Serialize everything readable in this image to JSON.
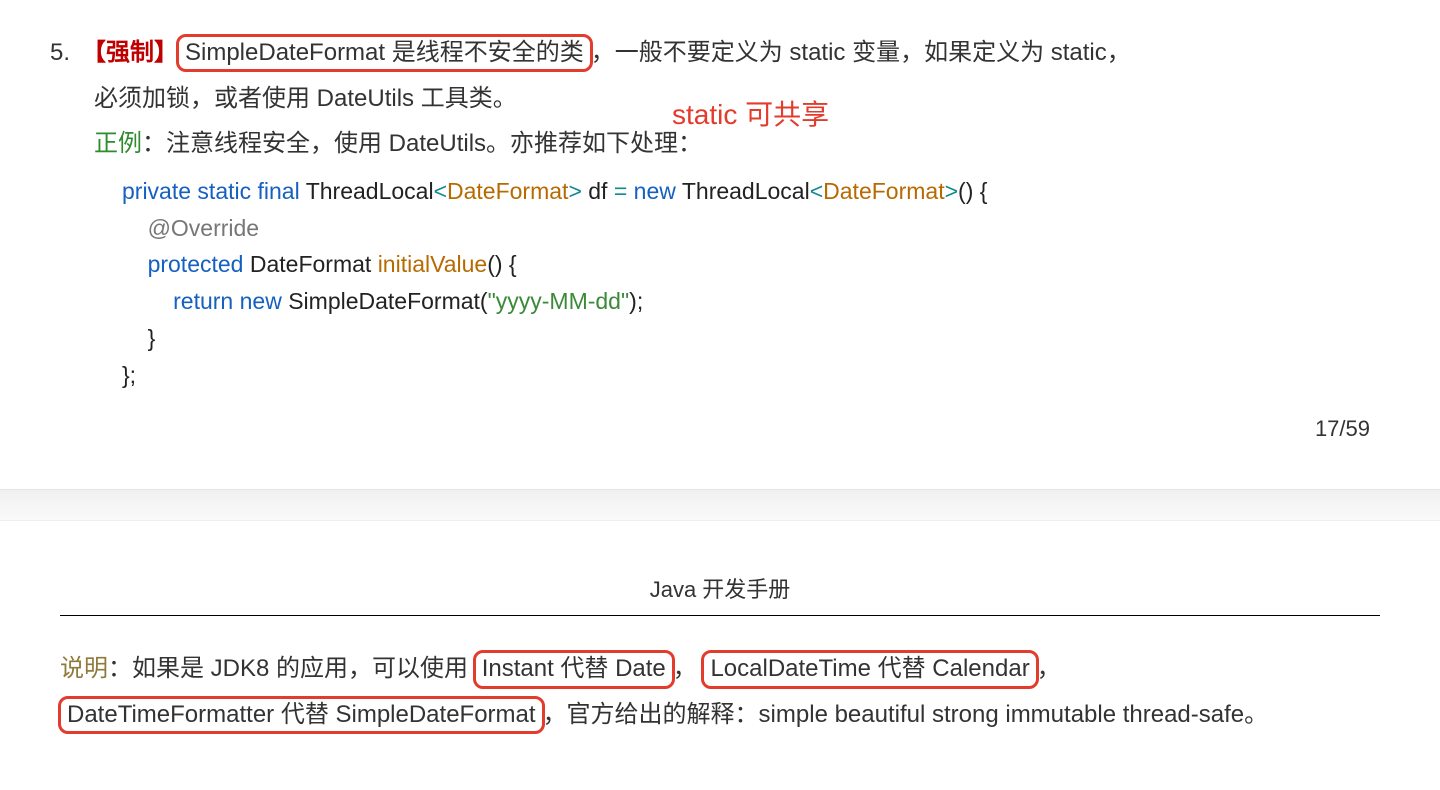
{
  "item": {
    "number": "5.",
    "tag_force": "【强制】",
    "hl_title": "SimpleDateFormat 是线程不安全的类",
    "rest1": "，一般不要定义为 static 变量，如果定义为 static，",
    "cont1": "必须加锁，或者使用 DateUtils 工具类。",
    "annotation": "static 可共享",
    "tag_good": "正例",
    "good_colon": "：注意线程安全，使用 DateUtils。亦推荐如下处理：",
    "code": {
      "l1a": "private",
      "l1b": " static",
      "l1c": " final",
      "l1d": " ThreadLocal",
      "l1e": "<",
      "l1f": "DateFormat",
      "l1g": ">",
      "l1h": " df ",
      "l1i": "=",
      "l1j": " new",
      "l1k": " ThreadLocal",
      "l1l": "<",
      "l1m": "DateFormat",
      "l1n": ">",
      "l1o": "() {",
      "l2": "@Override",
      "l3a": "protected",
      "l3b": " DateFormat ",
      "l3c": "initialValue",
      "l3d": "() {",
      "l4a": "return",
      "l4b": " new",
      "l4c": " SimpleDateFormat(",
      "l4d": "\"yyyy-MM-dd\"",
      "l4e": ");",
      "l5": "}",
      "l6": "};"
    },
    "page_num": "17/59"
  },
  "section_title": "Java 开发手册",
  "note": {
    "tag_note": "说明",
    "p1": "：如果是 JDK8 的应用，可以使用",
    "hl_a": "Instant 代替 Date",
    "sep1": "，",
    "hl_b": "LocalDateTime 代替 Calendar",
    "sep2": "，",
    "hl_c": "DateTimeFormatter 代替 SimpleDateFormat",
    "p2": "，官方给出的解释：simple beautiful strong immutable thread-safe。"
  }
}
